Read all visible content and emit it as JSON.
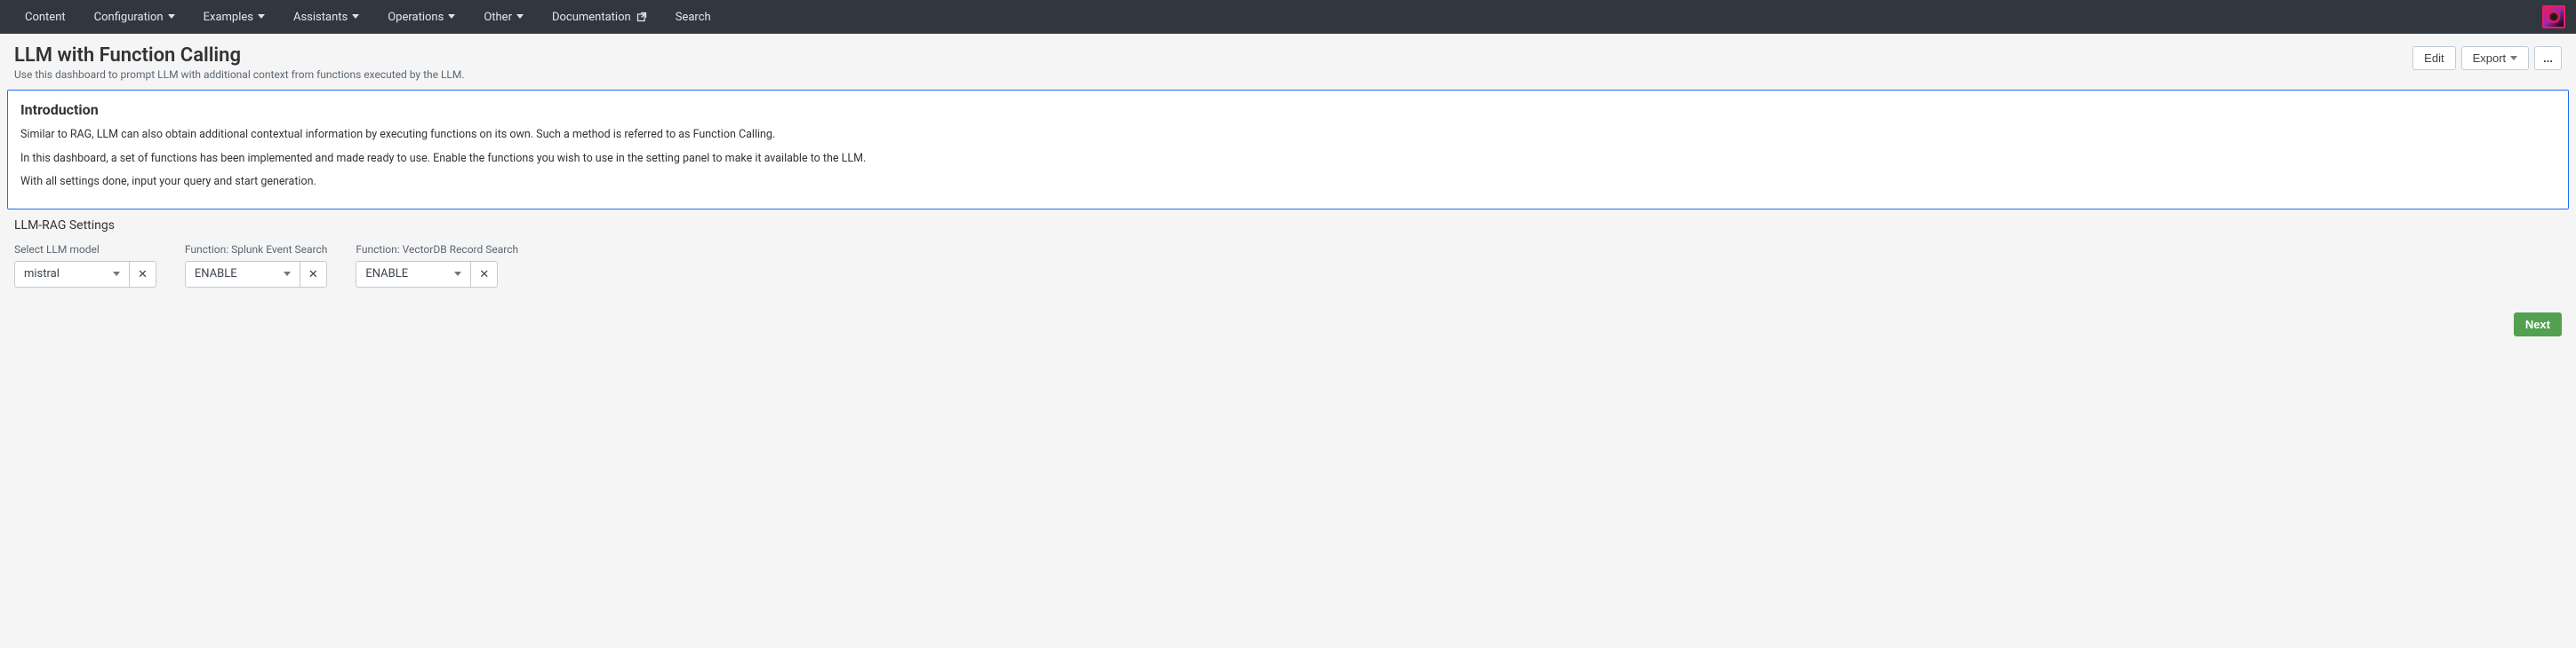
{
  "nav": {
    "items": [
      {
        "label": "Content",
        "dropdown": false
      },
      {
        "label": "Configuration",
        "dropdown": true
      },
      {
        "label": "Examples",
        "dropdown": true
      },
      {
        "label": "Assistants",
        "dropdown": true
      },
      {
        "label": "Operations",
        "dropdown": true
      },
      {
        "label": "Other",
        "dropdown": true
      },
      {
        "label": "Documentation",
        "dropdown": false,
        "external": true
      },
      {
        "label": "Search",
        "dropdown": false
      }
    ]
  },
  "header": {
    "title": "LLM with Function Calling",
    "subtitle": "Use this dashboard to prompt LLM with additional context from functions executed by the LLM.",
    "actions": {
      "edit": "Edit",
      "export": "Export",
      "more": "..."
    }
  },
  "intro": {
    "title": "Introduction",
    "p1": "Similar to RAG, LLM can also obtain additional contextual information by executing functions on its own. Such a method is referred to as Function Calling.",
    "p2": "In this dashboard, a set of functions has been implemented and made ready to use. Enable the functions you wish to use in the setting panel to make it available to the LLM.",
    "p3": "With all settings done, input your query and start generation."
  },
  "settings": {
    "title": "LLM-RAG Settings",
    "controls": [
      {
        "label": "Select LLM model",
        "value": "mistral"
      },
      {
        "label": "Function: Splunk Event Search",
        "value": "ENABLE"
      },
      {
        "label": "Function: VectorDB Record Search",
        "value": "ENABLE"
      }
    ]
  },
  "footer": {
    "next": "Next"
  }
}
